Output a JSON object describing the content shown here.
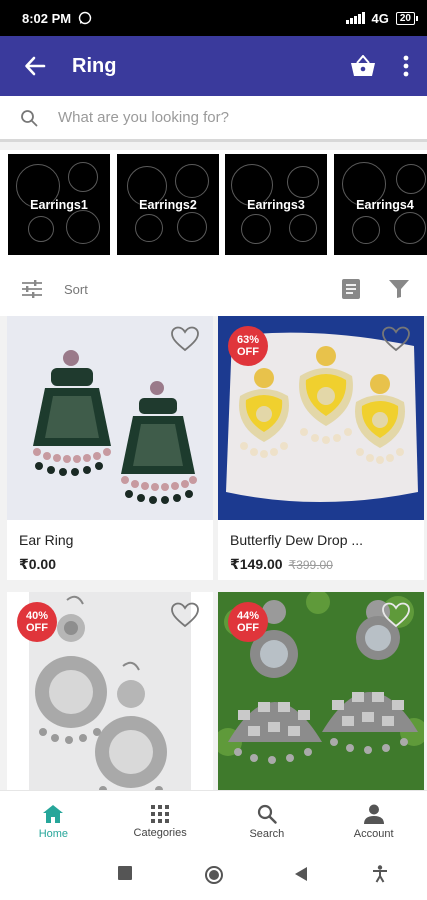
{
  "status_bar": {
    "time": "8:02 PM",
    "network": "4G",
    "battery": "20"
  },
  "app_bar": {
    "title": "Ring",
    "icons": [
      "back-arrow-icon",
      "basket-icon",
      "more-vert-icon"
    ]
  },
  "search": {
    "placeholder": "What are you looking for?"
  },
  "categories": [
    {
      "label": "Earrings1"
    },
    {
      "label": "Earrings2"
    },
    {
      "label": "Earrings3"
    },
    {
      "label": "Earrings4"
    }
  ],
  "toolbar": {
    "sort_label": "Sort"
  },
  "products": [
    {
      "name": "Ear Ring",
      "price": "₹0.00",
      "mrp": "",
      "discount_pct": "",
      "discount_label": ""
    },
    {
      "name": "Butterfly Dew Drop ...",
      "price": "₹149.00",
      "mrp": "₹399.00",
      "discount_pct": "63%",
      "discount_label": "OFF"
    },
    {
      "name": "",
      "price": "",
      "mrp": "",
      "discount_pct": "40%",
      "discount_label": "OFF"
    },
    {
      "name": "",
      "price": "",
      "mrp": "",
      "discount_pct": "44%",
      "discount_label": "OFF"
    }
  ],
  "bottom_nav": [
    {
      "label": "Home",
      "icon": "home-icon",
      "active": true
    },
    {
      "label": "Categories",
      "icon": "grid-dots-icon",
      "active": false
    },
    {
      "label": "Search",
      "icon": "search-icon",
      "active": false
    },
    {
      "label": "Account",
      "icon": "person-icon",
      "active": false
    }
  ],
  "colors": {
    "app_bar": "#3a3a9c",
    "accent": "#26a69a",
    "badge": "#e0353b"
  }
}
